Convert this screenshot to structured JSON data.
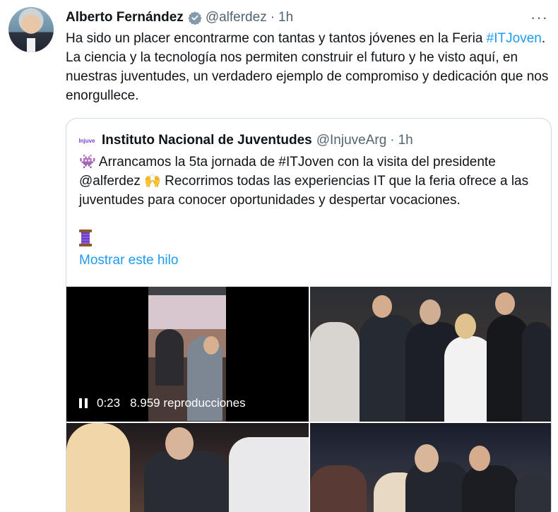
{
  "tweet": {
    "author_name": "Alberto Fernández",
    "handle": "@alferdez",
    "separator": "·",
    "time": "1h",
    "more": "···",
    "text_part1": "Ha sido un placer encontrarme con tantas y tantos jóvenes en la Feria ",
    "hashtag": "#ITJoven",
    "text_part2": ". La ciencia y la tecnología nos permiten construir el futuro y he visto aquí, en nuestras juventudes, un verdadero ejemplo de compromiso y dedicación que nos enorgullece."
  },
  "quote": {
    "avatar_text": "Injuve",
    "author_name": "Instituto Nacional de Juventudes",
    "handle": "@InjuveArg",
    "separator": "·",
    "time": "1h",
    "emoji1": "👾",
    "text_part1": " Arrancamos la 5ta jornada de #ITJoven con la visita del presidente @alferdez ",
    "emoji2": "🙌",
    "text_part2": " Recorrimos todas las experiencias IT que la feria ofrece a las juventudes para conocer oportunidades y despertar vocaciones.",
    "show_thread": "Mostrar este hilo"
  },
  "video": {
    "elapsed": "0:23",
    "views": "8.959 reproducciones"
  },
  "icons": {
    "verified": "verified-badge-icon",
    "more": "more-options-icon",
    "pause": "pause-icon",
    "spool": "thread-spool-icon"
  },
  "colors": {
    "accent": "#1d9bf0",
    "secondary_text": "#536471",
    "border": "#cfd9de"
  }
}
